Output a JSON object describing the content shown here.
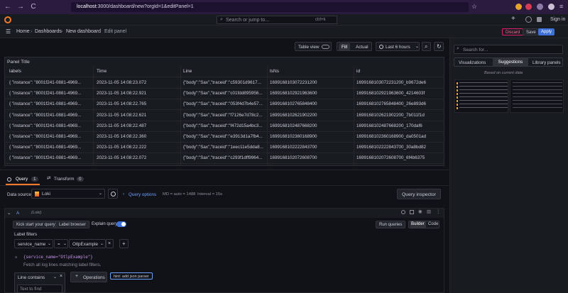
{
  "browser": {
    "url_host": "localhost",
    "url_path": ":3000/dashboard/new?orgId=1&editPanel=1",
    "back": "←",
    "forward": "→",
    "reload": "C"
  },
  "topbar": {
    "search_placeholder": "Search or jump to...",
    "shortcut": "ctrl+k",
    "plus": "+",
    "sign_in": "Sign in"
  },
  "breadcrumb": {
    "items": [
      "Home",
      "Dashboards",
      "New dashboard",
      "Edit panel"
    ],
    "sep": "›"
  },
  "actions": {
    "discard": "Discard",
    "save": "Save",
    "apply": "Apply"
  },
  "viz_controls": {
    "table_view": "Table view",
    "fill": "Fill",
    "actual": "Actual",
    "time_range": "Last 6 hours"
  },
  "panel": {
    "title": "Panel Title",
    "columns": [
      "labels",
      "Time",
      "Line",
      "tsNs",
      "id"
    ],
    "rows": [
      [
        "{ \"instance\": \"8001f241-0881-4969...",
        "2023-11-05 14:08:23.072",
        "{\"body\":\"Sax\",\"traceid\":\"c59301d9617...",
        "1699168103072231200",
        "1699168103072231200_b9672de6"
      ],
      [
        "{ \"instance\": \"8001f241-0881-4969...",
        "2023-11-05 14:08:22.921",
        "{\"body\":\"Sax\",\"traceid\":\"c01fdd895956...",
        "1699168102921963600",
        "1699168102921963600_4214603f"
      ],
      [
        "{ \"instance\": \"8001f241-0881-4969...",
        "2023-11-05 14:08:22.765",
        "{\"body\":\"Sax\",\"traceid\":\"053f4d7b4e57...",
        "1699168102765848400",
        "1699168102765848400_26e893d6"
      ],
      [
        "{ \"instance\": \"8001f241-0881-4969...",
        "2023-11-05 14:08:22.621",
        "{\"body\":\"Sax\",\"traceid\":\"f7126e7d78c2...",
        "1699168102621902200",
        "1699168102621902200_7b011f1d"
      ],
      [
        "{ \"instance\": \"8001f241-0881-4969...",
        "2023-11-05 14:08:22.487",
        "{\"body\":\"Sax\",\"traceid\":\"f472d15a4bc3...",
        "1699168102487668200",
        "1699168102487668200_170daf6"
      ],
      [
        "{ \"instance\": \"8001f241-0881-4969...",
        "2023-11-05 14:08:22.360",
        "{\"body\":\"Sax\",\"traceid\":\"e3913d1a7fb4...",
        "1699168102360168900",
        "1699168102360168900_da0501ad"
      ],
      [
        "{ \"instance\": \"8001f241-0881-4969...",
        "2023-11-05 14:08:22.222",
        "{\"body\":\"Sax\",\"traceid\":\"1eec11e5dda8...",
        "1699168102222843700",
        "1699168102222843700_30a8bd82"
      ],
      [
        "{ \"instance\": \"8001f241-0881-4969...",
        "2023-11-05 14:08:22.072",
        "{\"body\":\"Sax\",\"traceid\":\"c293f1dff9964...",
        "1699168102072608700",
        "1699168102072608700_6f4b6375"
      ]
    ]
  },
  "side": {
    "search_placeholder": "Search for...",
    "tabs": [
      "Visualizations",
      "Suggestions",
      "Library panels"
    ],
    "subtitle": "Based on current data"
  },
  "query_tabs": {
    "query": "Query",
    "query_count": "1",
    "transform": "Transform",
    "transform_count": "0"
  },
  "datasource": {
    "label": "Data source",
    "name": "Loki",
    "query_options": "Query options",
    "md": "MD = auto = 1488",
    "interval": "Interval = 15s",
    "inspector": "Query inspector"
  },
  "query": {
    "letter": "A",
    "source": "(Loki)",
    "kick_start": "Kick start your query",
    "label_browser": "Label browser",
    "explain": "Explain query",
    "run": "Run queries",
    "builder": "Builder",
    "code": "Code",
    "label_filters": "Label filters",
    "filter_key": "service_name",
    "filter_op": "=",
    "filter_value": "OtlpExample",
    "preview": "{service_name=\"OtlpExample\"}",
    "explain_text": "Fetch all log lines matching label filters.",
    "line_contains": "Line contains",
    "text_to_find": "Text to find",
    "operations": "Operations",
    "hint": "hint: add json parser"
  }
}
